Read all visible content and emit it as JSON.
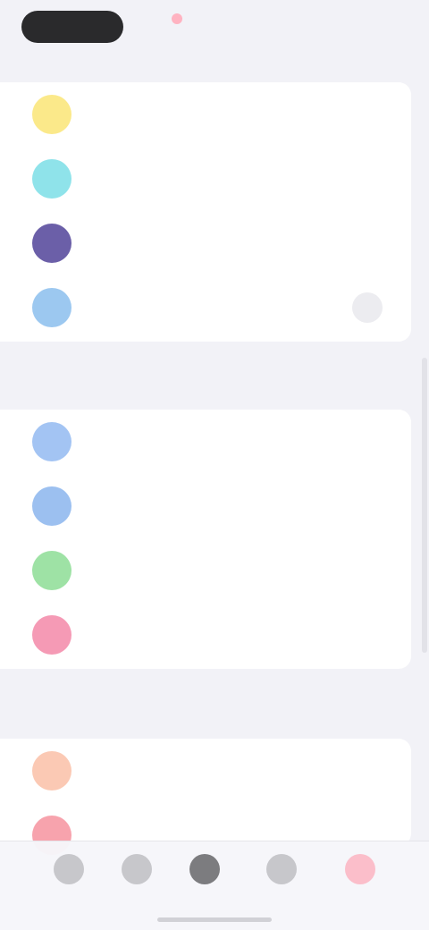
{
  "status_bar": {
    "pill_text": "",
    "center_text": "",
    "right_text": ""
  },
  "header": {
    "title": ""
  },
  "groups": [
    {
      "title": "",
      "rows": [
        {
          "label": "",
          "icon": "yellow-circle-icon",
          "color": "#fbe98a",
          "trailing": ""
        },
        {
          "label": "",
          "icon": "cyan-circle-icon",
          "color": "#8fe3ea",
          "trailing": ""
        },
        {
          "label": "",
          "icon": "purple-circle-icon",
          "color": "#6b5fa8",
          "trailing": ""
        },
        {
          "label": "",
          "icon": "blue-circle-icon",
          "color": "#9cc8f0",
          "trailing": ""
        }
      ]
    },
    {
      "title": "",
      "rows": [
        {
          "label": "",
          "icon": "blue-circle-icon",
          "color": "#a3c4f3"
        },
        {
          "label": "",
          "icon": "blue-circle-icon",
          "color": "#9cc0f0"
        },
        {
          "label": "",
          "icon": "green-circle-icon",
          "color": "#9ee2a5"
        },
        {
          "label": "",
          "icon": "pink-circle-icon",
          "color": "#f59ab5"
        }
      ]
    },
    {
      "title": "",
      "rows": [
        {
          "label": "",
          "icon": "peach-circle-icon",
          "color": "#fbc9b4"
        },
        {
          "label": "",
          "icon": "red-circle-icon",
          "color": "#f7a3ad"
        }
      ]
    }
  ],
  "tabs": [
    {
      "label": "",
      "icon": "tab-1-icon"
    },
    {
      "label": "",
      "icon": "tab-2-icon"
    },
    {
      "label": "",
      "icon": "tab-3-icon"
    },
    {
      "label": "",
      "icon": "tab-4-icon"
    },
    {
      "label": "",
      "icon": "settings-icon",
      "active": true
    }
  ]
}
